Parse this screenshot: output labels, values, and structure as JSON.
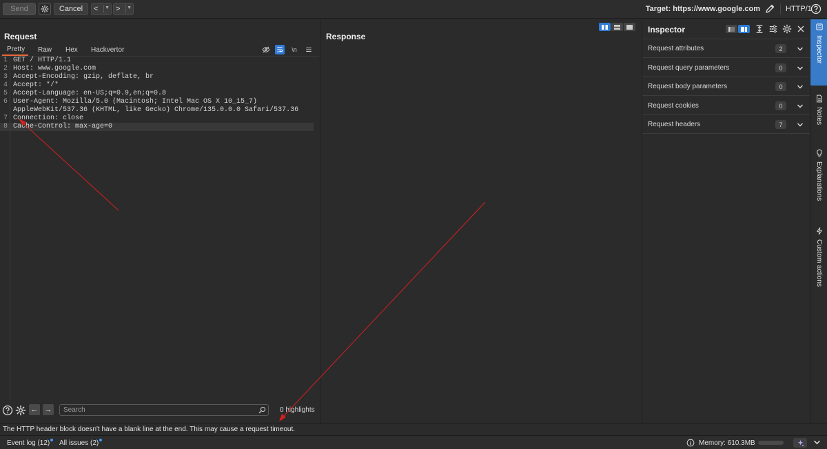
{
  "toolbar": {
    "send_label": "Send",
    "cancel_label": "Cancel",
    "back_label": "<",
    "forward_label": ">",
    "target_label": "Target: https://www.google.com",
    "http_version": "HTTP/1"
  },
  "request": {
    "title": "Request",
    "tabs": [
      "Pretty",
      "Raw",
      "Hex",
      "Hackvertor"
    ],
    "active_tab": "Pretty",
    "newline_toggle": "\\n",
    "lines": [
      {
        "num": "1",
        "text": "GET / HTTP/1.1"
      },
      {
        "num": "2",
        "text": "Host: www.google.com"
      },
      {
        "num": "3",
        "text": "Accept-Encoding: gzip, deflate, br"
      },
      {
        "num": "4",
        "text": "Accept: */*"
      },
      {
        "num": "5",
        "text": "Accept-Language: en-US;q=0.9,en;q=0.8"
      },
      {
        "num": "6",
        "text": "User-Agent: Mozilla/5.0 (Macintosh; Intel Mac OS X 10_15_7)"
      },
      {
        "num": "",
        "text": "AppleWebKit/537.36 (KHTML, like Gecko) Chrome/135.0.0.0 Safari/537.36"
      },
      {
        "num": "7",
        "text": "Connection: close"
      },
      {
        "num": "8",
        "text": "Cache-Control: max-age=0"
      }
    ],
    "search_placeholder": "Search",
    "highlights": "0 highlights"
  },
  "response": {
    "title": "Response"
  },
  "inspector": {
    "title": "Inspector",
    "rows": [
      {
        "label": "Request attributes",
        "count": "2"
      },
      {
        "label": "Request query parameters",
        "count": "0"
      },
      {
        "label": "Request body parameters",
        "count": "0"
      },
      {
        "label": "Request cookies",
        "count": "0"
      },
      {
        "label": "Request headers",
        "count": "7"
      }
    ]
  },
  "side_rail": {
    "tabs": [
      "Inspector",
      "Notes",
      "Explanations",
      "Custom actions"
    ]
  },
  "status_message": "The HTTP header block doesn't have a blank line at the end. This may cause a request timeout.",
  "bottom_bar": {
    "event_log": "Event log (12)",
    "all_issues": "All issues (2)",
    "memory": "Memory: 610.3MB"
  },
  "colors": {
    "accent_tab": "#e8673a",
    "active_blue": "#2f7bd6",
    "annotation_red": "#d42020"
  }
}
